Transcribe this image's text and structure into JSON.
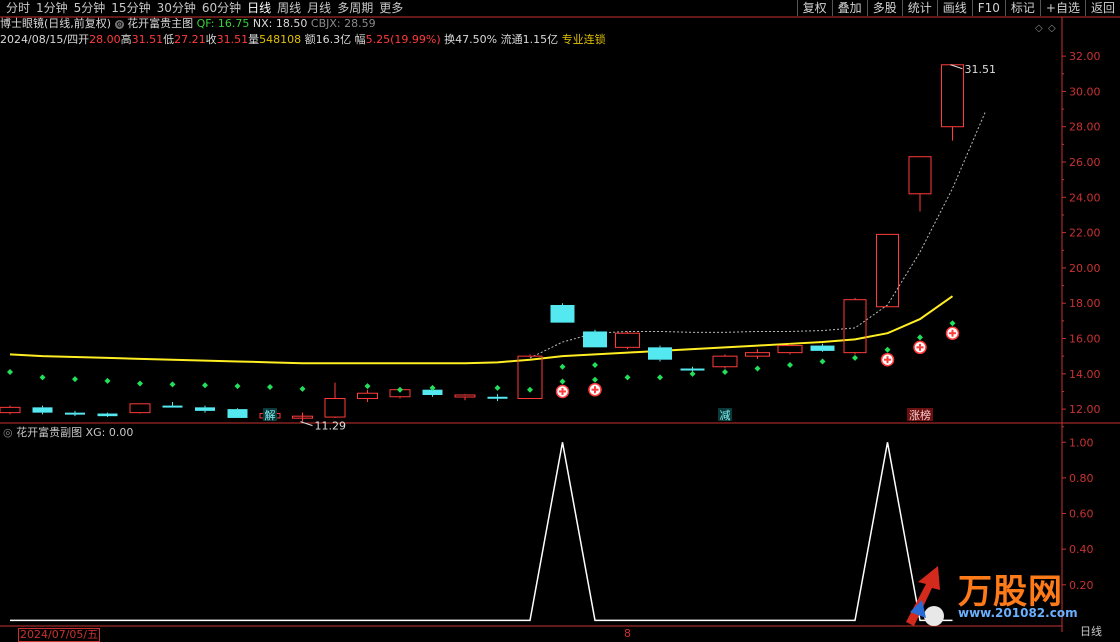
{
  "toolbar": {
    "period_tabs": [
      "分时",
      "1分钟",
      "5分钟",
      "15分钟",
      "30分钟",
      "60分钟",
      "日线",
      "周线",
      "月线",
      "多周期",
      "更多"
    ],
    "active_tab": "日线",
    "right_buttons": [
      "复权",
      "叠加",
      "多股",
      "统计",
      "画线",
      "F10",
      "标记",
      "+自选",
      "返回"
    ]
  },
  "main_header": {
    "tool_name": "博士眼镜(日线,前复权)",
    "indicator_name": "花开富贵主图",
    "qf_label": "QF: 16.75",
    "nx_label": "NX: 18.50",
    "cbjx_label": "CBJX: 28.59"
  },
  "quote_bar": {
    "date": "2024/08/15/四",
    "open_label": "开",
    "open": "28.00",
    "high_label": "高",
    "high": "31.51",
    "low_label": "低",
    "low": "27.21",
    "close_label": "收",
    "close": "31.51",
    "volume_label": "量",
    "volume": "548108",
    "amount": "额16.3亿",
    "change_label": "幅",
    "change": "5.25(19.99%)",
    "turnover": "换47.50%",
    "float": "流通1.15亿",
    "tag": "专业连锁"
  },
  "sub_header": {
    "indicator_name": "花开富贵副图",
    "xg_label": "XG: 0.00"
  },
  "bottom": {
    "start_date": "2024/07/05/五",
    "marker": "8",
    "unit": "日线"
  },
  "watermark": {
    "brand": "万股网",
    "url": "www.201082.com"
  },
  "colors": {
    "background": "#000000",
    "up": "#ff3b3b",
    "down": "#54e8f0",
    "ma": "#ffee22",
    "diamond": "#22e05a",
    "axis": "#c83232",
    "text": "#c8c8c8",
    "xg_line": "#ffffff"
  },
  "chart_data": [
    {
      "type": "candlestick",
      "y_ticks": [
        12.0,
        14.0,
        16.0,
        18.0,
        20.0,
        22.0,
        24.0,
        26.0,
        28.0,
        30.0,
        32.0
      ],
      "ylim": [
        11.1,
        32.8
      ],
      "candles": [
        {
          "o": 11.8,
          "h": 12.2,
          "l": 11.7,
          "c": 12.1
        },
        {
          "o": 12.1,
          "h": 12.2,
          "l": 11.7,
          "c": 11.8
        },
        {
          "o": 11.8,
          "h": 11.9,
          "l": 11.6,
          "c": 11.75
        },
        {
          "o": 11.75,
          "h": 11.8,
          "l": 11.55,
          "c": 11.6
        },
        {
          "o": 11.8,
          "h": 12.3,
          "l": 11.75,
          "c": 12.3
        },
        {
          "o": 12.2,
          "h": 12.4,
          "l": 12.1,
          "c": 12.15
        },
        {
          "o": 12.1,
          "h": 12.2,
          "l": 11.8,
          "c": 11.9
        },
        {
          "o": 12.0,
          "h": 12.05,
          "l": 11.5,
          "c": 11.5
        },
        {
          "o": 11.5,
          "h": 11.85,
          "l": 11.45,
          "c": 11.75
        },
        {
          "o": 11.6,
          "h": 11.8,
          "l": 11.29,
          "c": 11.6
        },
        {
          "o": 11.55,
          "h": 13.5,
          "l": 11.5,
          "c": 12.6
        },
        {
          "o": 12.6,
          "h": 13.1,
          "l": 12.4,
          "c": 12.9
        },
        {
          "o": 12.7,
          "h": 13.2,
          "l": 12.6,
          "c": 13.1
        },
        {
          "o": 13.1,
          "h": 13.3,
          "l": 12.7,
          "c": 12.8
        },
        {
          "o": 12.7,
          "h": 12.85,
          "l": 12.5,
          "c": 12.8
        },
        {
          "o": 12.7,
          "h": 12.85,
          "l": 12.45,
          "c": 12.6
        },
        {
          "o": 12.6,
          "h": 15.1,
          "l": 12.6,
          "c": 15.0
        },
        {
          "o": 17.9,
          "h": 18.0,
          "l": 16.9,
          "c": 16.9
        },
        {
          "o": 16.4,
          "h": 16.5,
          "l": 15.5,
          "c": 15.5
        },
        {
          "o": 15.5,
          "h": 16.4,
          "l": 15.4,
          "c": 16.3
        },
        {
          "o": 15.5,
          "h": 15.6,
          "l": 14.7,
          "c": 14.8
        },
        {
          "o": 14.3,
          "h": 14.4,
          "l": 14.05,
          "c": 14.2
        },
        {
          "o": 14.4,
          "h": 15.1,
          "l": 14.3,
          "c": 15.0
        },
        {
          "o": 15.0,
          "h": 15.4,
          "l": 14.85,
          "c": 15.2
        },
        {
          "o": 15.2,
          "h": 15.7,
          "l": 15.1,
          "c": 15.6
        },
        {
          "o": 15.6,
          "h": 15.7,
          "l": 15.25,
          "c": 15.3
        },
        {
          "o": 15.2,
          "h": 18.3,
          "l": 15.1,
          "c": 18.2
        },
        {
          "o": 17.8,
          "h": 21.9,
          "l": 17.8,
          "c": 21.9
        },
        {
          "o": 24.2,
          "h": 26.3,
          "l": 23.2,
          "c": 26.3
        },
        {
          "o": 28.0,
          "h": 31.51,
          "l": 27.21,
          "c": 31.51
        }
      ],
      "ma_line": [
        15.1,
        15.0,
        14.95,
        14.9,
        14.85,
        14.8,
        14.75,
        14.7,
        14.65,
        14.6,
        14.6,
        14.6,
        14.6,
        14.6,
        14.6,
        14.65,
        14.8,
        15.0,
        15.1,
        15.2,
        15.3,
        15.4,
        15.5,
        15.6,
        15.7,
        15.8,
        15.95,
        16.3,
        17.1,
        18.4
      ],
      "cost_line_start_index": 16,
      "cost_line": [
        14.9,
        15.8,
        16.3,
        16.4,
        16.4,
        16.35,
        16.35,
        16.4,
        16.4,
        16.45,
        16.6,
        17.9,
        20.9,
        24.5,
        28.8
      ],
      "diamond_markers": [
        {
          "i": 0,
          "v": 14.1
        },
        {
          "i": 1,
          "v": 13.8
        },
        {
          "i": 2,
          "v": 13.7
        },
        {
          "i": 3,
          "v": 13.6
        },
        {
          "i": 4,
          "v": 13.45
        },
        {
          "i": 5,
          "v": 13.4
        },
        {
          "i": 6,
          "v": 13.35
        },
        {
          "i": 7,
          "v": 13.3
        },
        {
          "i": 8,
          "v": 13.25
        },
        {
          "i": 9,
          "v": 13.15
        },
        {
          "i": 11,
          "v": 13.3
        },
        {
          "i": 12,
          "v": 13.1
        },
        {
          "i": 13,
          "v": 13.2
        },
        {
          "i": 15,
          "v": 13.2
        },
        {
          "i": 16,
          "v": 13.1
        },
        {
          "i": 17,
          "v": 14.4
        },
        {
          "i": 18,
          "v": 14.5
        },
        {
          "i": 19,
          "v": 13.8
        },
        {
          "i": 20,
          "v": 13.8
        },
        {
          "i": 21,
          "v": 14.0
        },
        {
          "i": 22,
          "v": 14.1
        },
        {
          "i": 23,
          "v": 14.3
        },
        {
          "i": 24,
          "v": 14.5
        },
        {
          "i": 25,
          "v": 14.7
        },
        {
          "i": 26,
          "v": 14.9
        }
      ],
      "buy_markers": [
        {
          "i": 17,
          "v": 13.0
        },
        {
          "i": 18,
          "v": 13.1
        },
        {
          "i": 27,
          "v": 14.8
        },
        {
          "i": 28,
          "v": 15.5
        },
        {
          "i": 29,
          "v": 16.3
        }
      ],
      "annotations": [
        {
          "i": 9,
          "value": "11.29",
          "pos": "low"
        },
        {
          "i": 29,
          "value": "31.51",
          "pos": "high"
        }
      ],
      "labels": [
        {
          "i": 8,
          "text": "解"
        },
        {
          "i": 22,
          "text": "减"
        },
        {
          "i": 28,
          "text": "涨榜"
        }
      ]
    },
    {
      "type": "line",
      "name": "XG",
      "y_ticks": [
        0.2,
        0.4,
        0.6,
        0.8,
        1.0
      ],
      "ylim": [
        -0.02,
        1.08
      ],
      "values": [
        0,
        0,
        0,
        0,
        0,
        0,
        0,
        0,
        0,
        0,
        0,
        0,
        0,
        0,
        0,
        0,
        0,
        1,
        0,
        0,
        0,
        0,
        0,
        0,
        0,
        0,
        0,
        1,
        0,
        0
      ]
    }
  ]
}
